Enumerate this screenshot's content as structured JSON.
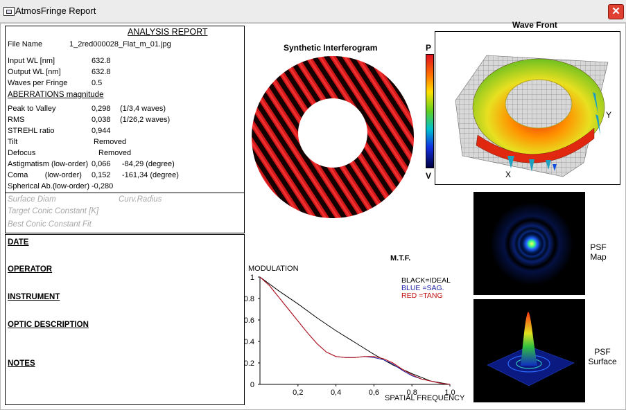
{
  "window": {
    "title": "AtmosFringe  Report",
    "close_label": "✕"
  },
  "report": {
    "heading": "ANALYSIS  REPORT",
    "file_name_label": "File Name",
    "file_name_value": "1_2red000028_Flat_m_01.jpg",
    "input_wl_label": "Input  WL [nm]",
    "input_wl_value": "632.8",
    "output_wl_label": "Output WL [nm]",
    "output_wl_value": "632.8",
    "waves_per_fringe_label": "Waves per Fringe",
    "waves_per_fringe_value": "0.5",
    "aberrations_heading": "ABERRATIONS magnitude",
    "pv_label": "Peak to Valley",
    "pv_value": "0,298",
    "pv_waves": "(1/3,4 waves)",
    "rms_label": "RMS",
    "rms_value": "0,038",
    "rms_waves": "(1/26,2 waves)",
    "strehl_label": "STREHL ratio",
    "strehl_value": "0,944",
    "tilt_label": "Tilt",
    "tilt_value": "Removed",
    "defocus_label": "Defocus",
    "defocus_value": "Removed",
    "astig_label": "Astigmatism  (low-order)",
    "astig_value": "0,066",
    "astig_angle": "-84,29  (degree)",
    "coma_label": "Coma        (low-order)",
    "coma_value": "0,152",
    "coma_angle": "-161,34  (degree)",
    "spherical_label": "Spherical Ab.(low-order)",
    "spherical_value": "-0,280",
    "surface_diam_label": "Surface Diam",
    "curv_radius_label": "Curv.Radius",
    "target_conic_label": "Target Conic Constant [K]",
    "best_conic_label": "Best Conic Constant Fit"
  },
  "info": {
    "date_label": "DATE",
    "operator_label": "OPERATOR",
    "instrument_label": "INSTRUMENT",
    "optic_label": "OPTIC DESCRIPTION",
    "notes_label": "NOTES"
  },
  "interferogram": {
    "title": "Synthetic Interferogram"
  },
  "colorbar": {
    "top_label": "P",
    "bottom_label": "V"
  },
  "wavefront": {
    "title": "Wave Front",
    "x_axis": "X",
    "y_axis": "Y"
  },
  "psf": {
    "map_label": "PSF Map",
    "surface_label": "PSF Surface"
  },
  "chart_data": {
    "type": "line",
    "title": "M.T.F.",
    "ylabel": "MODULATION",
    "xlabel": "SPATIAL FREQUENCY",
    "xlim": [
      0,
      1
    ],
    "ylim": [
      0,
      1
    ],
    "x_ticks": [
      "0,2",
      "0,4",
      "0,6",
      "0,8",
      "1,0"
    ],
    "y_ticks": [
      "0",
      "0.2",
      "0.4",
      "0.6",
      "0.8",
      "1"
    ],
    "legend": [
      "BLACK=IDEAL",
      "BLUE  =SAG.",
      "RED    =TANG"
    ],
    "series": [
      {
        "name": "IDEAL",
        "color": "#000000",
        "x": [
          0,
          0.1,
          0.2,
          0.3,
          0.4,
          0.5,
          0.6,
          0.7,
          0.8,
          0.9,
          1.0
        ],
        "y": [
          1.0,
          0.87,
          0.75,
          0.62,
          0.5,
          0.39,
          0.28,
          0.18,
          0.1,
          0.03,
          0.0
        ]
      },
      {
        "name": "SAG.",
        "color": "#1a1aa0",
        "x": [
          0,
          0.05,
          0.1,
          0.15,
          0.2,
          0.25,
          0.3,
          0.35,
          0.4,
          0.45,
          0.5,
          0.55,
          0.6,
          0.65,
          0.7,
          0.75,
          0.8,
          0.85,
          0.9,
          0.95,
          1.0
        ],
        "y": [
          1.0,
          0.92,
          0.81,
          0.7,
          0.59,
          0.48,
          0.38,
          0.3,
          0.26,
          0.25,
          0.25,
          0.26,
          0.25,
          0.23,
          0.19,
          0.13,
          0.08,
          0.05,
          0.03,
          0.01,
          0.0
        ]
      },
      {
        "name": "TANG",
        "color": "#c01010",
        "x": [
          0,
          0.05,
          0.1,
          0.15,
          0.2,
          0.25,
          0.3,
          0.35,
          0.4,
          0.45,
          0.5,
          0.55,
          0.6,
          0.65,
          0.7,
          0.75,
          0.8,
          0.85,
          0.9,
          0.95,
          1.0
        ],
        "y": [
          1.0,
          0.92,
          0.81,
          0.7,
          0.59,
          0.48,
          0.38,
          0.3,
          0.26,
          0.25,
          0.25,
          0.26,
          0.26,
          0.24,
          0.2,
          0.14,
          0.09,
          0.05,
          0.03,
          0.01,
          0.0
        ]
      }
    ]
  },
  "colors": {
    "fringe_red": "#d01818",
    "fringe_dark": "#140000",
    "close_red": "#e04030"
  }
}
